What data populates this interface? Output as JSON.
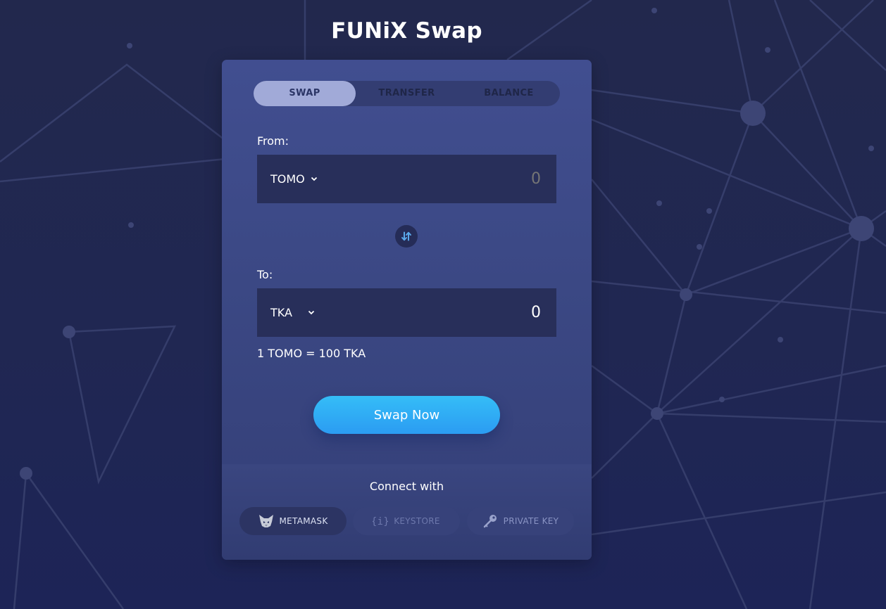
{
  "app": {
    "title": "FUNiX Swap"
  },
  "tabs": [
    {
      "label": "SWAP",
      "active": true
    },
    {
      "label": "TRANSFER",
      "active": false
    },
    {
      "label": "BALANCE",
      "active": false
    }
  ],
  "swap": {
    "from_label": "From:",
    "from_token": "TOMO",
    "from_amount_placeholder": "0",
    "to_label": "To:",
    "to_token": "TKA",
    "to_amount": "0",
    "rate": "1 TOMO = 100 TKA",
    "swap_button": "Swap Now"
  },
  "connect": {
    "title": "Connect with",
    "options": [
      {
        "label": "METAMASK",
        "icon": "fox-icon"
      },
      {
        "label": "KEYSTORE",
        "icon": "keystore-icon"
      },
      {
        "label": "PRIVATE KEY",
        "icon": "key-icon"
      }
    ]
  },
  "colors": {
    "background": "#22284d",
    "card": "#414e90",
    "field": "#282f5a",
    "accent": "#35bdf7",
    "tab_active": "#a1aad8"
  }
}
